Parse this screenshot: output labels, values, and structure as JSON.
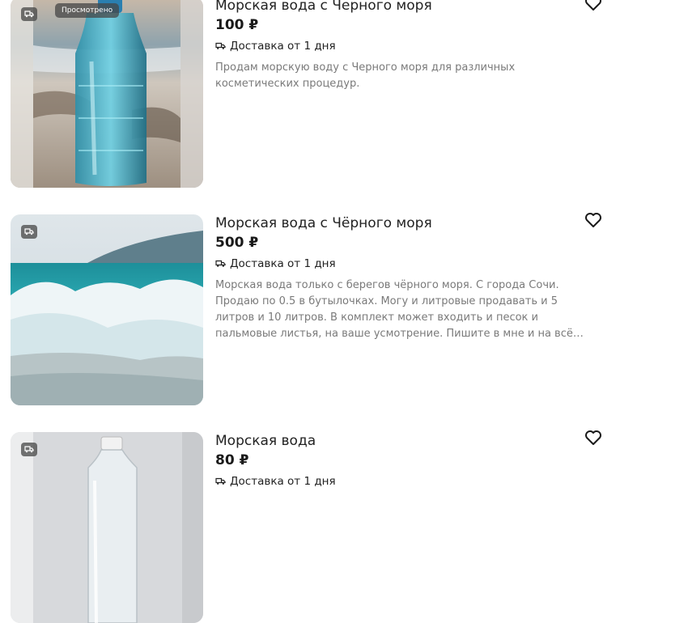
{
  "listings": [
    {
      "title": "Морская вода с Черного моря",
      "price": "100 ₽",
      "delivery": "Доставка от 1 дня",
      "description": "Продам морскую воду с Черного моря для различных косметических процедур.",
      "badge": "Просмотрено"
    },
    {
      "title": "Морская вода с Чёрного моря",
      "price": "500 ₽",
      "delivery": "Доставка от 1 дня",
      "description": "Морская вода только с берегов чёрного моря. С города Сочи. Продаю по 0.5 в бутылочках. Могу и литровые продавать и 5 литров и 10 литров. В комплект может входить и песок и пальмовые листья, на ваше усмотрение. Пишите в мне и на всё…"
    },
    {
      "title": "Морская вода",
      "price": "80 ₽",
      "delivery": "Доставка от 1 дня"
    }
  ],
  "icons": {
    "delivery": "truck-icon",
    "favorite": "heart-icon"
  },
  "colors": {
    "text": "#222222",
    "description": "#7a7a7a",
    "badge_bg": "#464646"
  }
}
